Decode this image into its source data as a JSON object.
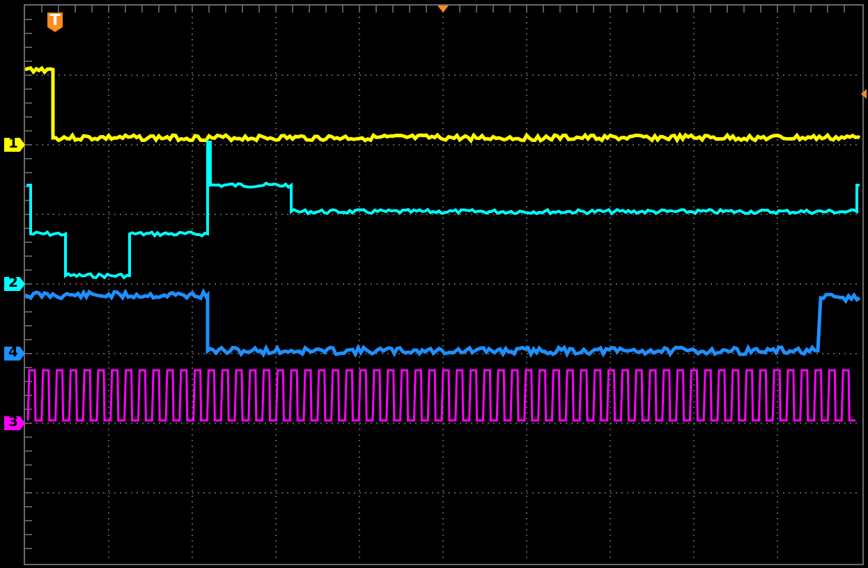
{
  "trigger": {
    "label": "T"
  },
  "channels": [
    {
      "label": "1",
      "color": "#ffff00",
      "kind": "yellow-trace"
    },
    {
      "label": "2",
      "color": "#00ffff",
      "kind": "cyan-trace"
    },
    {
      "label": "4",
      "color": "#1e90ff",
      "kind": "blue-trace"
    },
    {
      "label": "3",
      "color": "#ff00ff",
      "kind": "pulse-trace"
    }
  ]
}
